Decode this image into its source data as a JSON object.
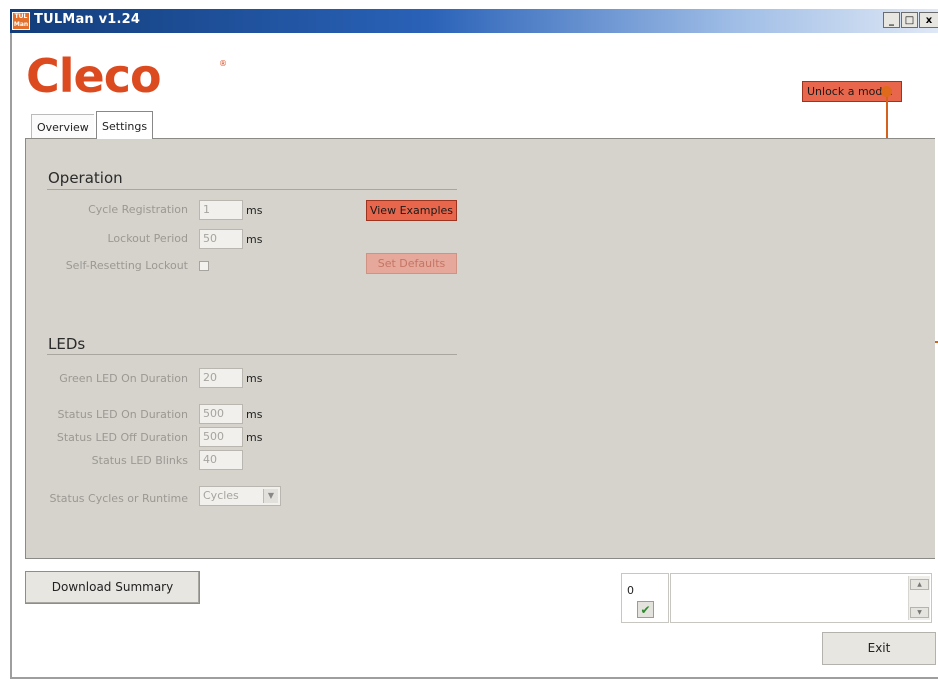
{
  "window": {
    "title": "TULMan v1.24",
    "icon_text": "TUL Man",
    "minimize": "_",
    "maximize": "□",
    "close": "x"
  },
  "logo": {
    "text": "Cleco",
    "registered": "®"
  },
  "header": {
    "unlock_button": "Unlock a mod..."
  },
  "tabs": [
    {
      "label": "Overview"
    },
    {
      "label": "Settings",
      "active": true
    }
  ],
  "operation": {
    "heading": "Operation",
    "cycle_registration": {
      "label": "Cycle Registration",
      "value": "1",
      "unit": "ms"
    },
    "lockout_period": {
      "label": "Lockout Period",
      "value": "50",
      "unit": "ms"
    },
    "self_resetting_lockout": {
      "label": "Self-Resetting Lockout",
      "checked": false
    },
    "view_examples_button": "View Examples",
    "set_defaults_button": "Set Defaults"
  },
  "leds": {
    "heading": "LEDs",
    "green_on_duration": {
      "label": "Green LED On Duration",
      "value": "20",
      "unit": "ms"
    },
    "status_on_duration": {
      "label": "Status LED On Duration",
      "value": "500",
      "unit": "ms"
    },
    "status_off_duration": {
      "label": "Status LED Off Duration",
      "value": "500",
      "unit": "ms"
    },
    "status_blinks": {
      "label": "Status LED Blinks",
      "value": "40"
    },
    "status_cycles_or_runtime": {
      "label": "Status Cycles or Runtime",
      "selected": "Cycles"
    }
  },
  "footer": {
    "download_summary_button": "Download Summary",
    "counter": "0",
    "exit_button": "Exit"
  },
  "colors": {
    "accent": "#e8664b",
    "brand": "#dc4b20",
    "panel": "#d6d3cc",
    "callout": "#d4621c"
  }
}
